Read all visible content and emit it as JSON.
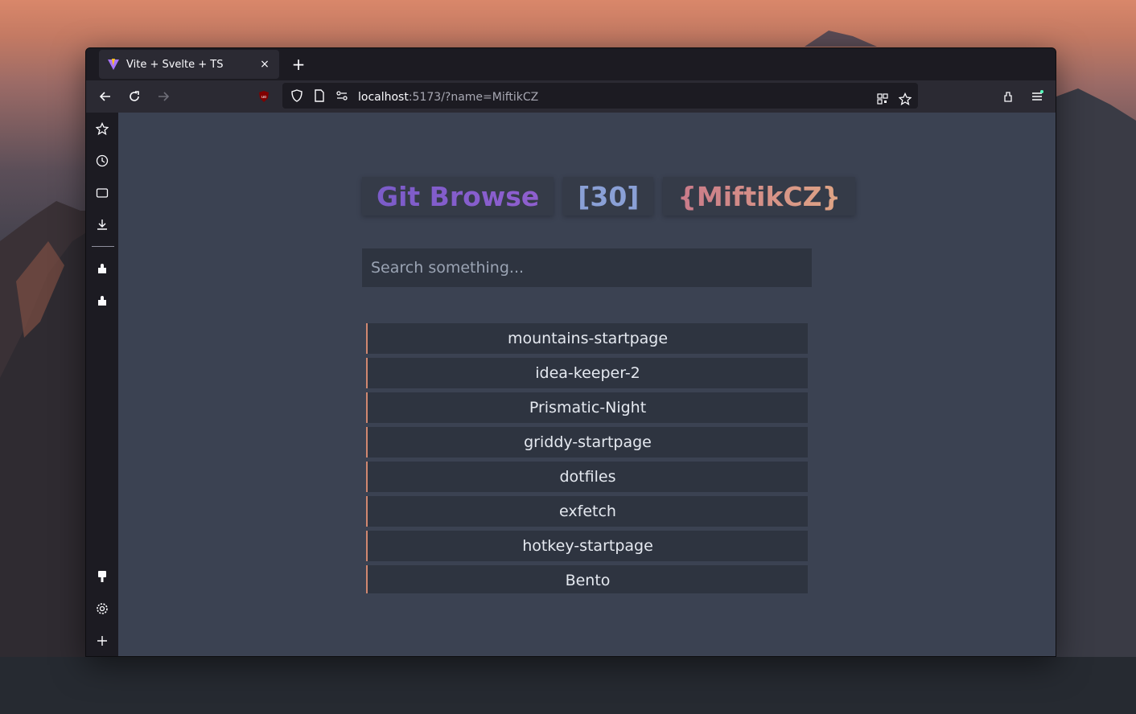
{
  "browser": {
    "tab": {
      "title": "Vite + Svelte + TS",
      "close_glyph": "×",
      "favicon": "vite-icon"
    },
    "new_tab_glyph": "+",
    "url": {
      "host": "localhost",
      "rest": ":5173/?name=MiftikCZ"
    },
    "nav_icons": [
      "back-icon",
      "reload-icon",
      "forward-icon",
      "ublock-icon",
      "shield-icon",
      "page-icon",
      "permissions-icon"
    ],
    "url_end_icons": [
      "qr-code-icon",
      "bookmark-star-icon"
    ],
    "toolbar_icons": [
      "extensions-icon",
      "menu-icon"
    ],
    "sidebar_icons": [
      "bookmarks-icon",
      "history-icon",
      "tabs-icon",
      "downloads-icon",
      "extension-icon",
      "extension-icon",
      "theme-icon",
      "settings-icon",
      "add-icon"
    ]
  },
  "app": {
    "title": "Git Browse",
    "count": "[30]",
    "user": "{MiftikCZ}",
    "search_placeholder": "Search something...",
    "repos": [
      "mountains-startpage",
      "idea-keeper-2",
      "Prismatic-Night",
      "griddy-startpage",
      "dotfiles",
      "exfetch",
      "hotkey-startpage",
      "Bento"
    ]
  },
  "colors": {
    "page_bg": "#3b4252",
    "card_bg": "#2e3440",
    "accent_border": "#d08770",
    "title_purple": "#8f5fcf",
    "count_blue": "#8aa0d6",
    "user_peach": "#e0a585"
  }
}
